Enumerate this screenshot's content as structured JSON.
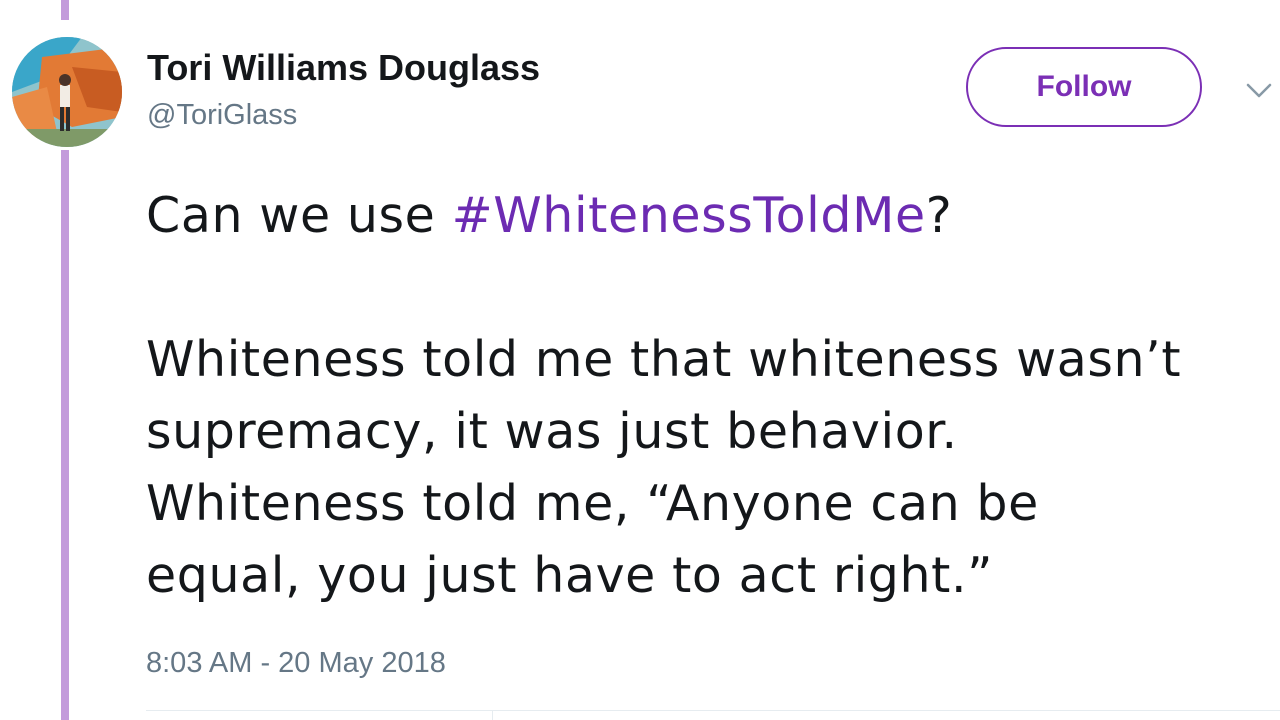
{
  "user": {
    "display_name": "Tori Williams Douglass",
    "handle": "@ToriGlass",
    "avatar_icon": "profile-photo"
  },
  "follow_button": {
    "label": "Follow"
  },
  "menu": {
    "icon": "chevron-down-icon"
  },
  "tweet": {
    "line1_before": "Can we use ",
    "hashtag": "#WhitenessToldMe",
    "line1_after": "?",
    "lines": [
      "Whiteness told me that whiteness wasn’t",
      "supremacy, it was just behavior.",
      "Whiteness told me, “Anyone can be",
      "equal, you just have to act right.”"
    ]
  },
  "timestamp": "8:03 AM - 20 May 2018",
  "colors": {
    "accent": "#7b2fb5",
    "hashtag": "#6c2bb2",
    "thread_line": "#c39bdb",
    "text": "#14171a",
    "secondary_text": "#657786"
  }
}
